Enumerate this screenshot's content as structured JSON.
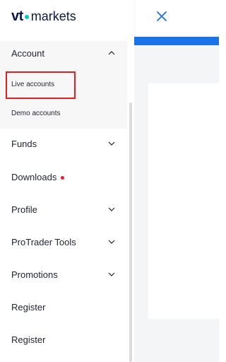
{
  "brand": {
    "logo_vt": "vt",
    "logo_markets": "markets",
    "accent_color": "#00c9c8"
  },
  "nav": {
    "account": {
      "label": "Account",
      "expanded": true,
      "items": [
        {
          "label": "Live accounts",
          "highlighted": true
        },
        {
          "label": "Demo accounts"
        }
      ]
    },
    "funds": {
      "label": "Funds"
    },
    "downloads": {
      "label": "Downloads",
      "badge_color": "#e0202e"
    },
    "profile": {
      "label": "Profile"
    },
    "protrader": {
      "label": "ProTrader Tools"
    },
    "promotions": {
      "label": "Promotions"
    },
    "register1": {
      "label": "Register"
    },
    "register2": {
      "label": "Register"
    }
  },
  "colors": {
    "header_bar": "#1a73e8",
    "close_icon": "#1a73e8",
    "highlight": "#e02020"
  },
  "icons": {
    "close": "close-icon",
    "chevron_up": "chevron-up-icon",
    "chevron_down": "chevron-down-icon"
  }
}
